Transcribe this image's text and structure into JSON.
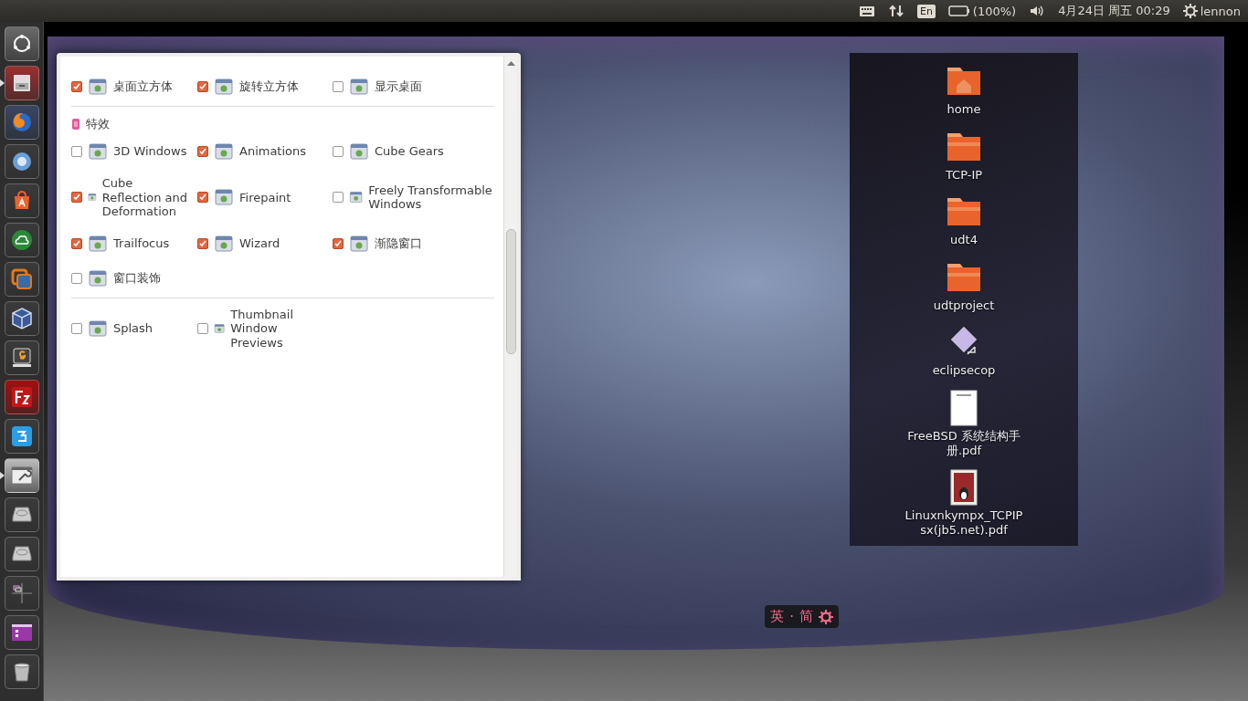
{
  "top_panel": {
    "keyboard_layout": "En",
    "battery": "(100%)",
    "clock": "4月24日 周五 00:29",
    "user": "lennon"
  },
  "launcher": {
    "items": [
      {
        "kind": "dash",
        "running": false
      },
      {
        "kind": "files",
        "running": true
      },
      {
        "kind": "browser",
        "running": false
      },
      {
        "kind": "chromium",
        "running": false
      },
      {
        "kind": "store",
        "running": false
      },
      {
        "kind": "cloud",
        "running": false
      },
      {
        "kind": "vm",
        "running": false
      },
      {
        "kind": "virtualbox",
        "running": false
      },
      {
        "kind": "editor",
        "running": false
      },
      {
        "kind": "ftp",
        "running": false
      },
      {
        "kind": "chat",
        "running": false
      },
      {
        "kind": "settings",
        "running": true
      },
      {
        "kind": "drive",
        "running": false
      },
      {
        "kind": "drive",
        "running": false
      },
      {
        "kind": "workspaces",
        "running": false
      },
      {
        "kind": "window",
        "running": false
      },
      {
        "kind": "trash",
        "running": false
      }
    ]
  },
  "settings_window": {
    "sections": [
      {
        "items": [
          {
            "label": "桌面立方体",
            "checked": true
          },
          {
            "label": "旋转立方体",
            "checked": true
          },
          {
            "label": "显示桌面",
            "checked": false
          }
        ]
      },
      {
        "heading": "特效",
        "items": [
          {
            "label": "3D Windows",
            "checked": false
          },
          {
            "label": "Animations",
            "checked": true
          },
          {
            "label": "Cube Gears",
            "checked": false
          },
          {
            "label": "Cube Reflection and Deformation",
            "checked": true
          },
          {
            "label": "Firepaint",
            "checked": true
          },
          {
            "label": "Freely Transformable Windows",
            "checked": false
          },
          {
            "label": "Trailfocus",
            "checked": true
          },
          {
            "label": "Wizard",
            "checked": true
          },
          {
            "label": "渐隐窗口",
            "checked": true
          },
          {
            "label": "窗口装饰",
            "checked": false
          }
        ]
      },
      {
        "items": [
          {
            "label": "Splash",
            "checked": false
          },
          {
            "label": "Thumbnail Window Previews",
            "checked": false
          }
        ]
      }
    ]
  },
  "input_method": {
    "mode": "英",
    "separator": "·",
    "script": "简"
  },
  "desktop_icons": [
    {
      "kind": "home",
      "label": "home"
    },
    {
      "kind": "folder",
      "label": "TCP-IP"
    },
    {
      "kind": "folder",
      "label": "udt4"
    },
    {
      "kind": "folder",
      "label": "udtproject"
    },
    {
      "kind": "shortcut",
      "label": "eclipsecop"
    },
    {
      "kind": "document",
      "label": "FreeBSD 系统结构手册.pdf"
    },
    {
      "kind": "book",
      "label": "Linuxnkympx_TCPIPsx(jb5.net).pdf"
    }
  ]
}
